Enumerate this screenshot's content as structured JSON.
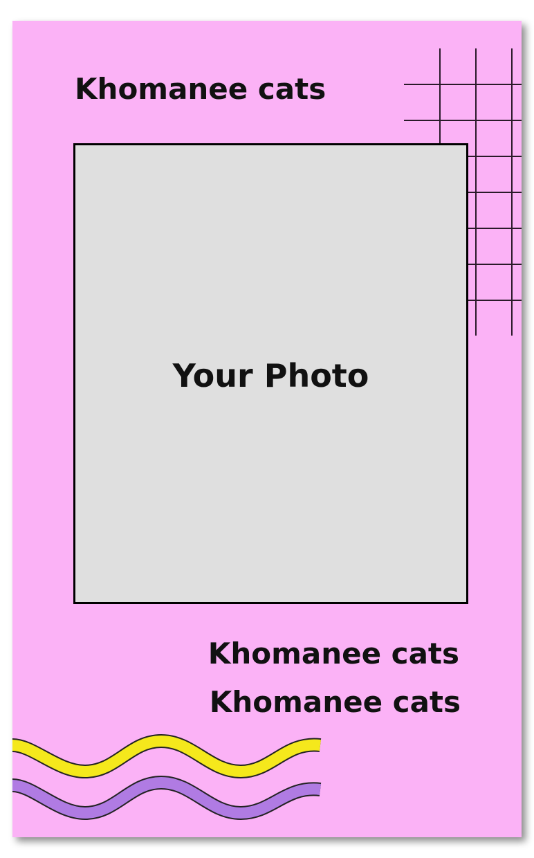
{
  "card": {
    "background": "#fbb2f6",
    "title_top": "Khomanee cats",
    "title_bottom_1": "Khomanee cats",
    "title_bottom_2": "Khomanee cats"
  },
  "photo": {
    "label": "Your Photo",
    "background": "#dfdfdf"
  },
  "decorations": {
    "grid_color": "#2a1a2a",
    "wave_colors": [
      "#f5e81c",
      "#b07be3"
    ]
  }
}
